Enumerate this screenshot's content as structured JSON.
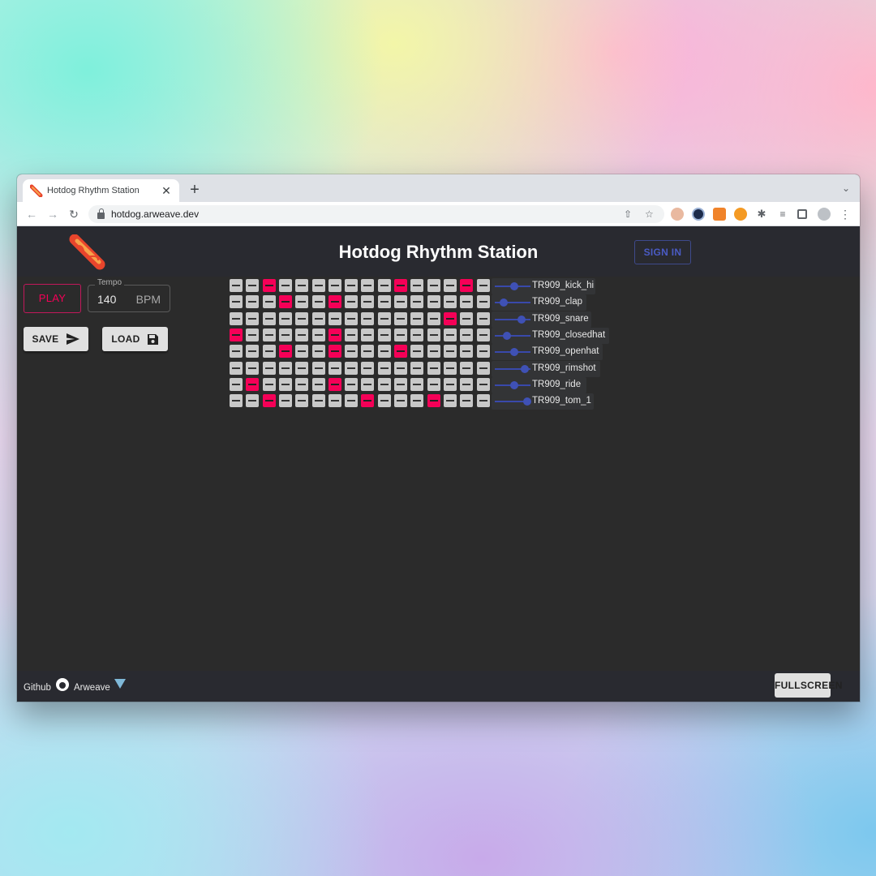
{
  "browser": {
    "tab_title": "Hotdog Rhythm Station",
    "url": "hotdog.arweave.dev"
  },
  "app": {
    "title": "Hotdog Rhythm Station",
    "sign_in_label": "SIGN IN"
  },
  "controls": {
    "play_label": "PLAY",
    "tempo_label": "Tempo",
    "tempo_value": "140",
    "tempo_unit": "BPM",
    "save_label": "SAVE",
    "load_label": "LOAD"
  },
  "sequencer": {
    "tracks": [
      {
        "name": "TR909_kick_hi",
        "volume": 0.55,
        "steps": [
          0,
          0,
          1,
          0,
          0,
          0,
          0,
          0,
          0,
          0,
          1,
          0,
          0,
          0,
          1,
          0
        ]
      },
      {
        "name": "TR909_clap",
        "volume": 0.25,
        "steps": [
          0,
          0,
          0,
          1,
          0,
          0,
          1,
          0,
          0,
          0,
          0,
          0,
          0,
          0,
          0,
          0
        ]
      },
      {
        "name": "TR909_snare",
        "volume": 0.75,
        "steps": [
          0,
          0,
          0,
          0,
          0,
          0,
          0,
          0,
          0,
          0,
          0,
          0,
          0,
          1,
          0,
          0
        ]
      },
      {
        "name": "TR909_closedhat",
        "volume": 0.35,
        "steps": [
          1,
          0,
          0,
          0,
          0,
          0,
          1,
          0,
          0,
          0,
          0,
          0,
          0,
          0,
          0,
          0
        ]
      },
      {
        "name": "TR909_openhat",
        "volume": 0.55,
        "steps": [
          0,
          0,
          0,
          1,
          0,
          0,
          1,
          0,
          0,
          0,
          1,
          0,
          0,
          0,
          0,
          0
        ]
      },
      {
        "name": "TR909_rimshot",
        "volume": 0.85,
        "steps": [
          0,
          0,
          0,
          0,
          0,
          0,
          0,
          0,
          0,
          0,
          0,
          0,
          0,
          0,
          0,
          0
        ]
      },
      {
        "name": "TR909_ride",
        "volume": 0.55,
        "steps": [
          0,
          1,
          0,
          0,
          0,
          0,
          1,
          0,
          0,
          0,
          0,
          0,
          0,
          0,
          0,
          0
        ]
      },
      {
        "name": "TR909_tom_1",
        "volume": 0.9,
        "steps": [
          0,
          0,
          1,
          0,
          0,
          0,
          0,
          0,
          1,
          0,
          0,
          0,
          1,
          0,
          0,
          0
        ]
      }
    ]
  },
  "footer": {
    "github_label": "Github",
    "arweave_label": "Arweave",
    "fullscreen_label": "FULLSCREEN"
  }
}
